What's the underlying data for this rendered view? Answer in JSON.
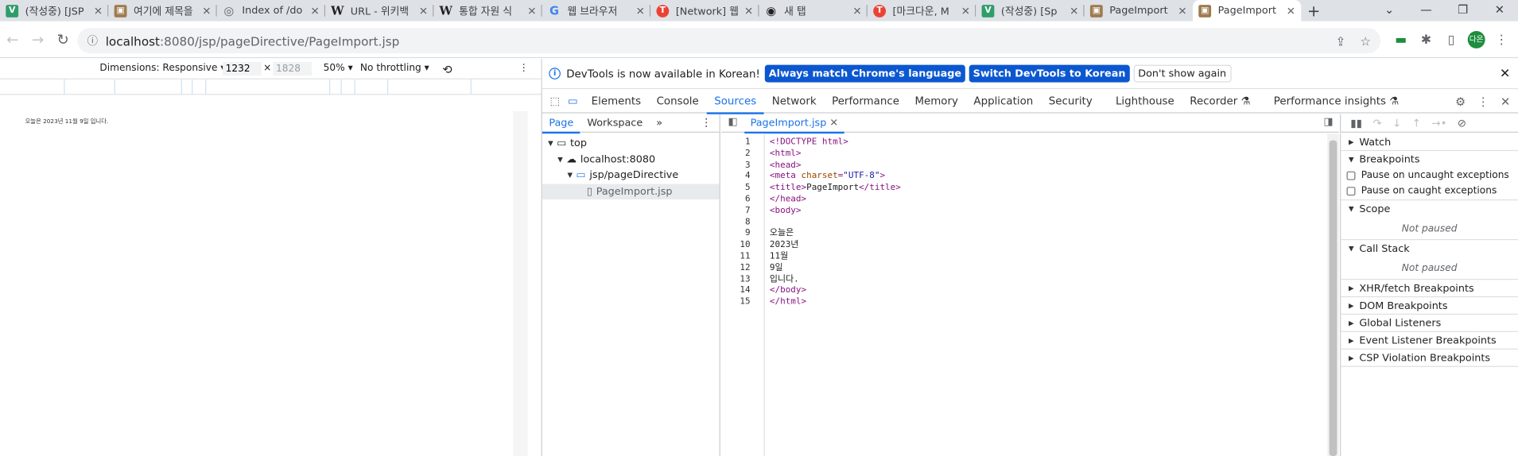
{
  "tabs": [
    {
      "title": "(작성중) [JSP",
      "favicon": "V",
      "color": "#2e9d6a",
      "icon": "vlog-icon"
    },
    {
      "title": "여기에 제목을",
      "favicon": "▣",
      "color": "#9e7b4f",
      "icon": "image-icon"
    },
    {
      "title": "Index of /do",
      "favicon": "◎",
      "color": "#5f6368",
      "icon": "globe-icon"
    },
    {
      "title": "URL - 위키백",
      "favicon": "W",
      "color": "#202124",
      "icon": "wikipedia-icon"
    },
    {
      "title": "통합 자원 식",
      "favicon": "W",
      "color": "#202124",
      "icon": "wikipedia-icon"
    },
    {
      "title": "웹 브라우저",
      "favicon": "G",
      "color": "#4285f4",
      "icon": "google-icon"
    },
    {
      "title": "[Network] 웹",
      "favicon": "T",
      "color": "#ea4335",
      "icon": "tistory-icon"
    },
    {
      "title": "새 탭",
      "favicon": "◉",
      "color": "#5f6368",
      "icon": "github-icon"
    },
    {
      "title": "[마크다운, M",
      "favicon": "T",
      "color": "#ea4335",
      "icon": "tistory-icon"
    },
    {
      "title": "(작성중) [Sp",
      "favicon": "V",
      "color": "#2e9d6a",
      "icon": "vlog-icon"
    },
    {
      "title": "PageImport",
      "favicon": "▣",
      "color": "#9e7b4f",
      "icon": "image-icon"
    },
    {
      "title": "PageImport",
      "favicon": "▣",
      "color": "#9e7b4f",
      "icon": "image-icon"
    }
  ],
  "address": {
    "host": "localhost",
    "path": ":8080/jsp/pageDirective/PageImport.jsp"
  },
  "avatar": "다온",
  "device_toolbar": {
    "dimensions": "Dimensions: Responsive",
    "width": "1232",
    "times": "×",
    "height": "1828",
    "zoom": "50%",
    "throttling": "No throttling"
  },
  "page": {
    "text": "오늘은 2023년 11월 9일 입니다."
  },
  "infobar": {
    "message": "DevTools is now available in Korean!",
    "match_button": "Always match Chrome's language",
    "switch_button": "Switch DevTools to Korean",
    "dismiss_button": "Don't show again"
  },
  "devtools_tabs": [
    "Elements",
    "Console",
    "Sources",
    "Network",
    "Performance",
    "Memory",
    "Application",
    "Security",
    "Lighthouse",
    "Recorder",
    "Performance insights"
  ],
  "active_tab": "Sources",
  "navigator": {
    "tabs": [
      "Page",
      "Workspace"
    ],
    "tree": [
      "top",
      "localhost:8080",
      "jsp/pageDirective",
      "PageImport.jsp"
    ]
  },
  "editor": {
    "file": "PageImport.jsp",
    "line_numbers": [
      "1",
      "2",
      "3",
      "4",
      "5",
      "6",
      "7",
      "8",
      "9",
      "10",
      "11",
      "12",
      "13",
      "14",
      "15"
    ]
  },
  "code": {
    "l1": "<!DOCTYPE html>",
    "l2": "<html>",
    "l3": "<head>",
    "l4_tag": "<meta ",
    "l4_attr": "charset",
    "l4_eq": "=",
    "l4_val": "\"UTF-8\"",
    "l4_end": ">",
    "l5_open": "<title>",
    "l5_text": "PageImport",
    "l5_close": "</title>",
    "l6": "</head>",
    "l7": "<body>",
    "l8": "",
    "l9": "오늘은",
    "l10": "2023년",
    "l11": "11월",
    "l12": "9일",
    "l13": "입니다.",
    "l14": "</body>",
    "l15": "</html>"
  },
  "debugger": {
    "watch": "Watch",
    "breakpoints": "Breakpoints",
    "pause_uncaught": "Pause on uncaught exceptions",
    "pause_caught": "Pause on caught exceptions",
    "scope": "Scope",
    "not_paused": "Not paused",
    "call_stack": "Call Stack",
    "sections": [
      "XHR/fetch Breakpoints",
      "DOM Breakpoints",
      "Global Listeners",
      "Event Listener Breakpoints",
      "CSP Violation Breakpoints"
    ]
  }
}
